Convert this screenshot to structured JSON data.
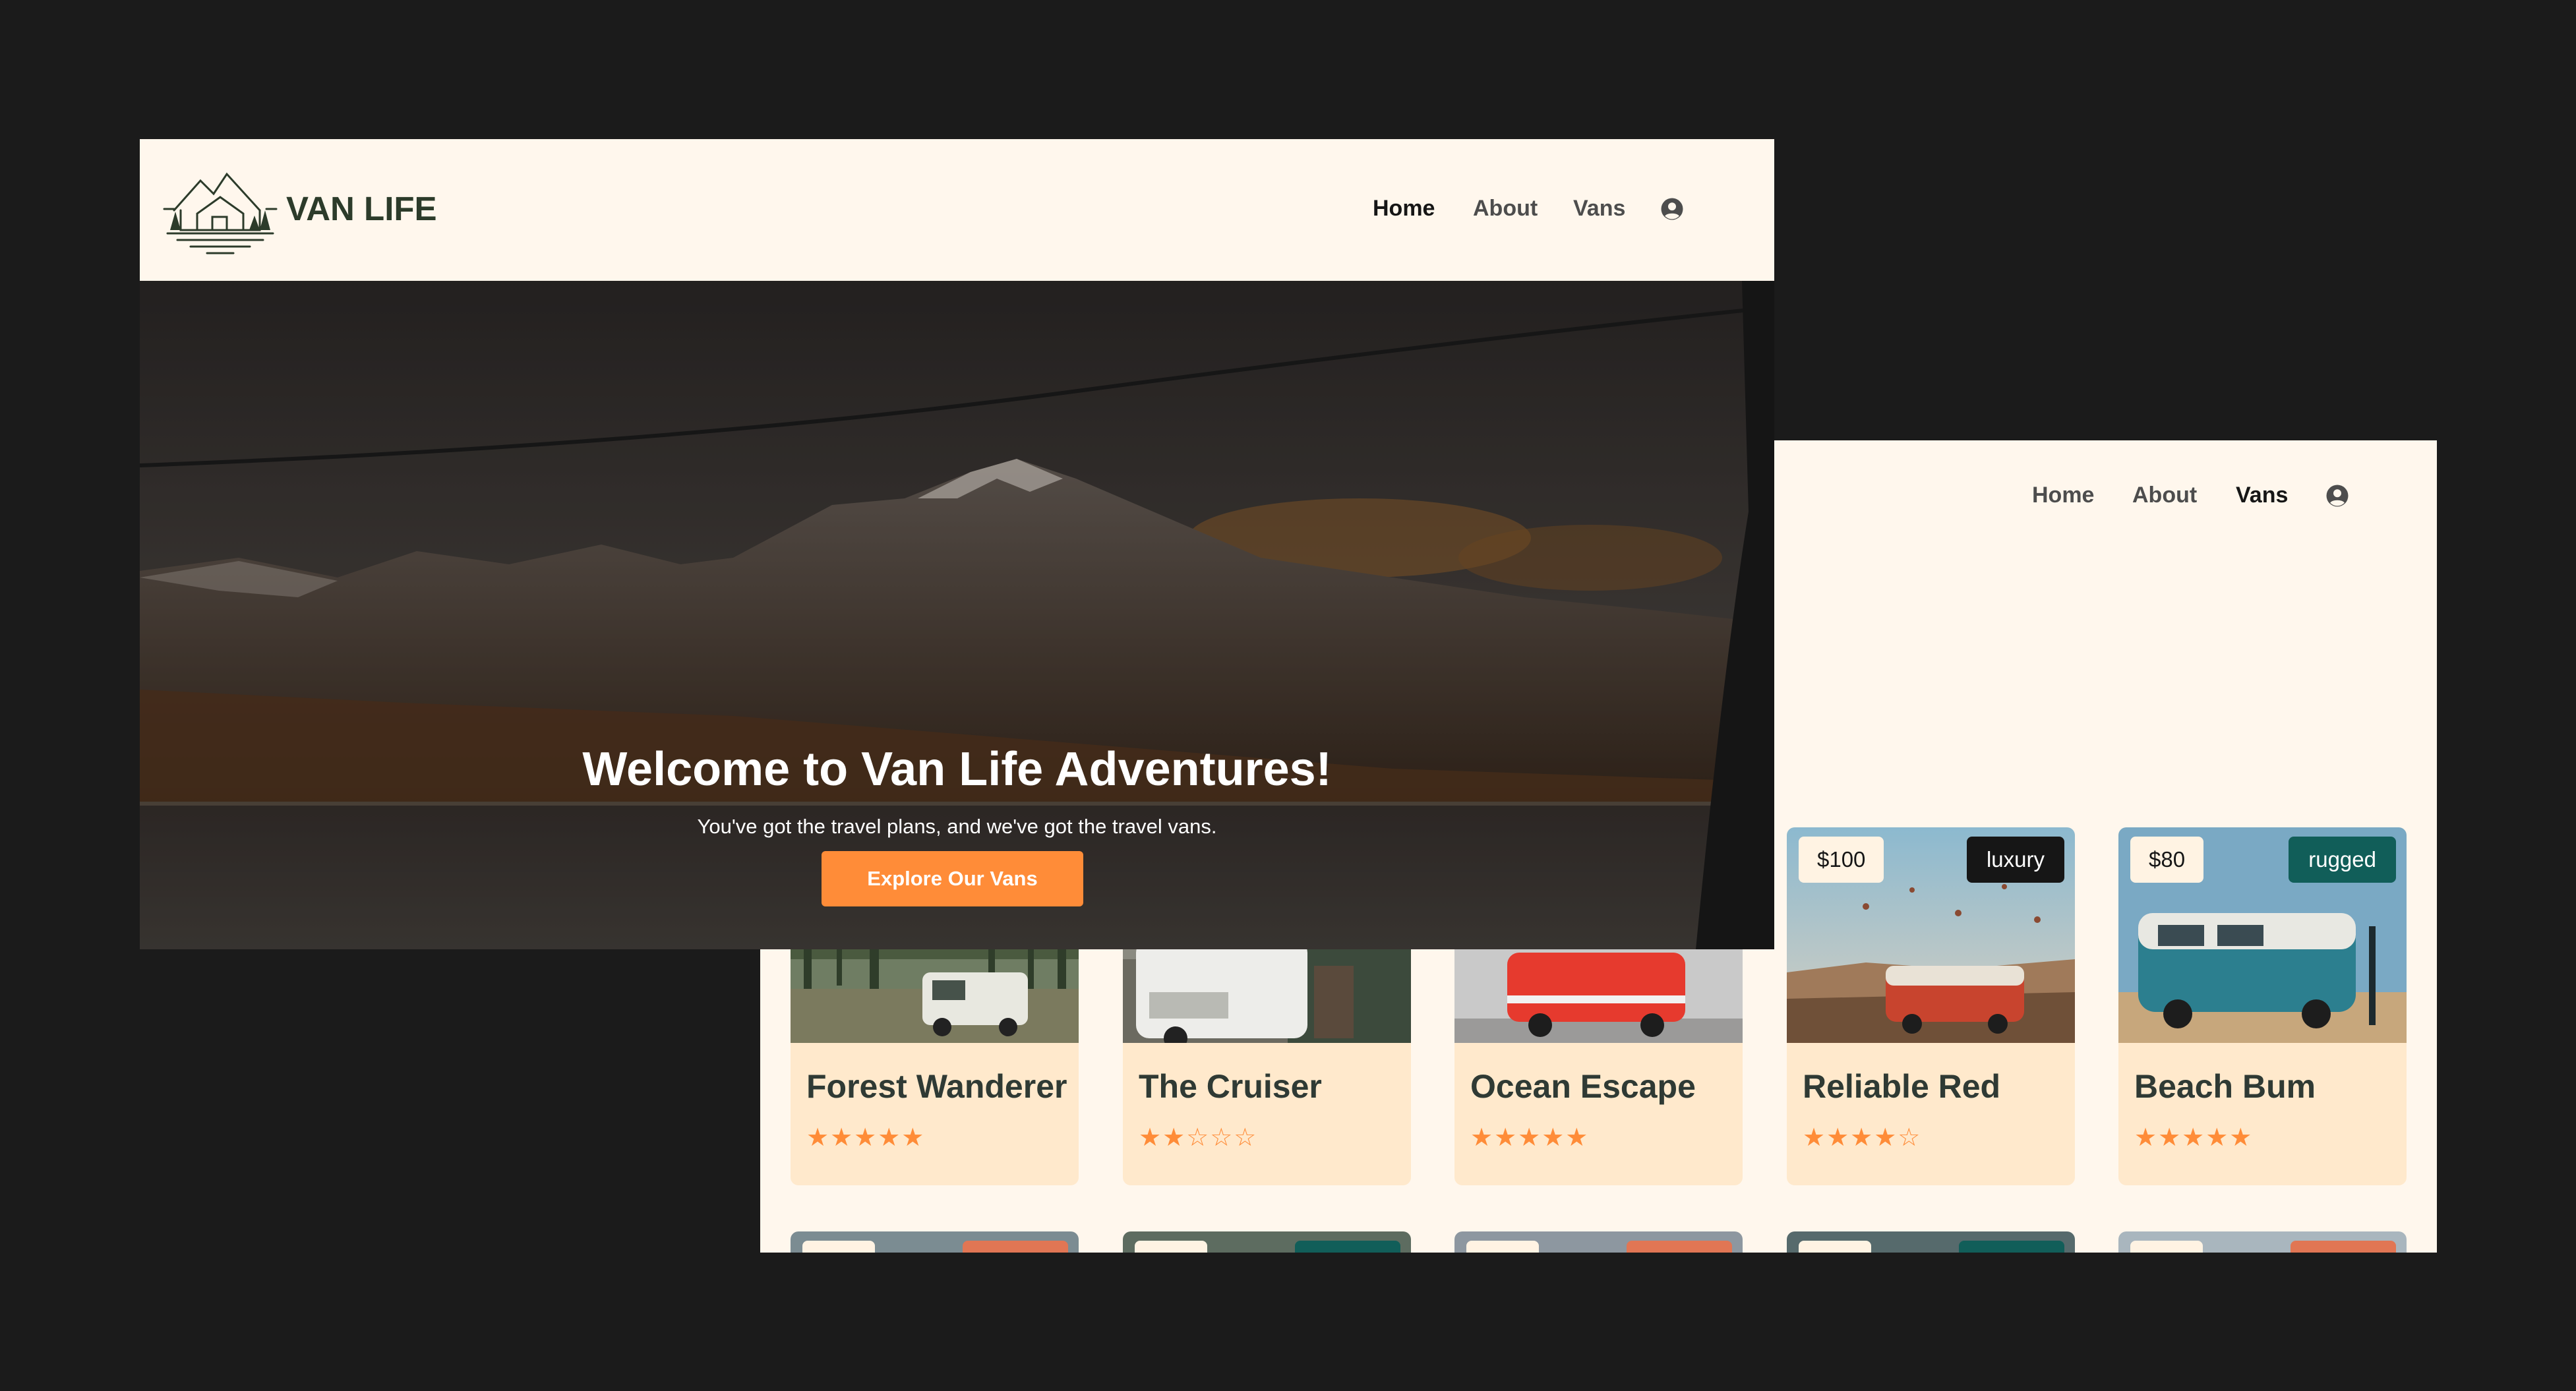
{
  "brand": {
    "name": "VAN LIFE",
    "logo_icon": "mountain-cabin-logo-icon"
  },
  "home": {
    "nav": {
      "home": "Home",
      "about": "About",
      "vans": "Vans",
      "user_icon": "user-circle-icon"
    },
    "hero": {
      "title": "Welcome to Van Life Adventures!",
      "subtitle": "You've got the travel plans, and we've got the travel vans.",
      "cta": "Explore Our Vans"
    }
  },
  "vans_page": {
    "nav": {
      "home": "Home",
      "about": "About",
      "vans": "Vans",
      "user_icon": "user-circle-icon"
    },
    "cards": [
      {
        "name": "Forest Wanderer",
        "stars": "★★★★★",
        "rating": 5
      },
      {
        "name": "The Cruiser",
        "stars": "★★☆☆☆",
        "rating": 2
      },
      {
        "name": "Ocean Escape",
        "stars": "★★★★★",
        "rating": 5
      },
      {
        "name": "Reliable Red",
        "price": "$100",
        "type": "luxury",
        "stars": "★★★★☆",
        "rating": 4
      },
      {
        "name": "Beach Bum",
        "price": "$80",
        "type": "rugged",
        "stars": "★★★★★",
        "rating": 5
      }
    ]
  },
  "colors": {
    "accent": "#ff8c38",
    "cream": "#fff7ed",
    "card": "#ffe9cc",
    "luxury_badge": "#161616",
    "rugged_badge": "#115e59",
    "simple_badge": "#e17654",
    "background": "#1b1b1b"
  }
}
